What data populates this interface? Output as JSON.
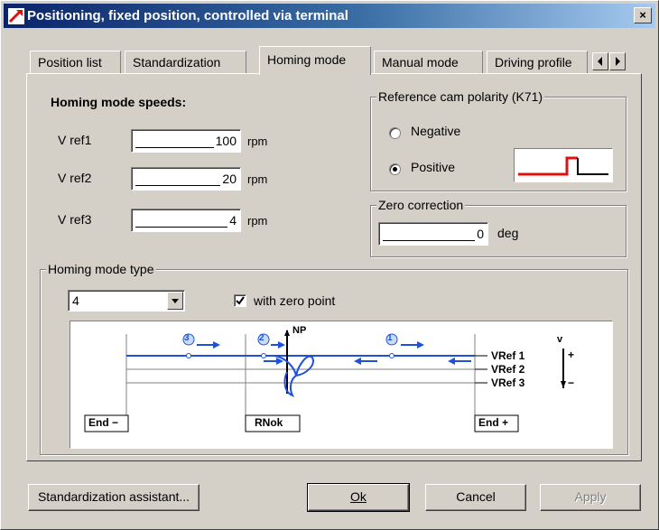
{
  "window": {
    "title": "Positioning, fixed position, controlled via terminal",
    "close_glyph": "×"
  },
  "tabs": [
    {
      "label": "Position list",
      "active": false
    },
    {
      "label": "Standardization",
      "active": false
    },
    {
      "label": "Homing mode",
      "active": true
    },
    {
      "label": "Manual mode",
      "active": false
    },
    {
      "label": "Driving profile",
      "active": false
    }
  ],
  "speeds": {
    "heading": "Homing mode speeds:",
    "unit": "rpm",
    "rows": [
      {
        "label": "V ref1",
        "value": "100"
      },
      {
        "label": "V ref2",
        "value": "20"
      },
      {
        "label": "V ref3",
        "value": "4"
      }
    ]
  },
  "cam_polarity": {
    "title": "Reference cam polarity (K71)",
    "options": [
      {
        "label": "Negative",
        "selected": false
      },
      {
        "label": "Positive",
        "selected": true
      }
    ]
  },
  "zero_correction": {
    "title": "Zero correction",
    "value": "0",
    "unit": "deg"
  },
  "homing_type": {
    "title": "Homing mode type",
    "selected": "4",
    "with_zero_point_label": "with zero point",
    "with_zero_point_checked": true,
    "diagram": {
      "np_label": "NP",
      "vref_labels": [
        "VRef 1",
        "VRef 2",
        "VRef 3"
      ],
      "end_minus_label": "End −",
      "rnok_label": "RNok",
      "end_plus_label": "End +",
      "step_numbers": [
        "3",
        "2",
        "1"
      ],
      "v_label": "v",
      "plus_sign": "+",
      "minus_sign": "−"
    }
  },
  "buttons": {
    "assistant": "Standardization assistant...",
    "ok": "Ok",
    "cancel": "Cancel",
    "apply": "Apply"
  },
  "colors": {
    "title_start": "#0a246a",
    "title_end": "#a6caf0",
    "face": "#d4d0c8",
    "diagram_blue": "#1e50dc",
    "cam_red": "#e01010"
  }
}
